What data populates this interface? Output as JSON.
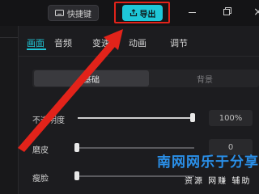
{
  "titlebar": {
    "shortcut_label": "快捷键",
    "export_label": "导出"
  },
  "tabs": [
    {
      "label": "画面"
    },
    {
      "label": "音频"
    },
    {
      "label": "变速"
    },
    {
      "label": "动画"
    },
    {
      "label": "调节"
    }
  ],
  "subtabs": {
    "basic": "基础",
    "background": "背景"
  },
  "properties": {
    "opacity": {
      "label": "不透明度",
      "value": "100%",
      "level": 1.0
    },
    "smooth": {
      "label": "磨皮",
      "value": "0",
      "level": 0.0
    },
    "slim": {
      "label": "瘦脸",
      "level": 0.0
    }
  },
  "watermark": {
    "main": "南网网乐于分享",
    "sub": "资源 网赚 辅助"
  },
  "colors": {
    "accent": "#20c5d6",
    "annotation": "#e2231a",
    "watermark": "#2a8fe8"
  }
}
